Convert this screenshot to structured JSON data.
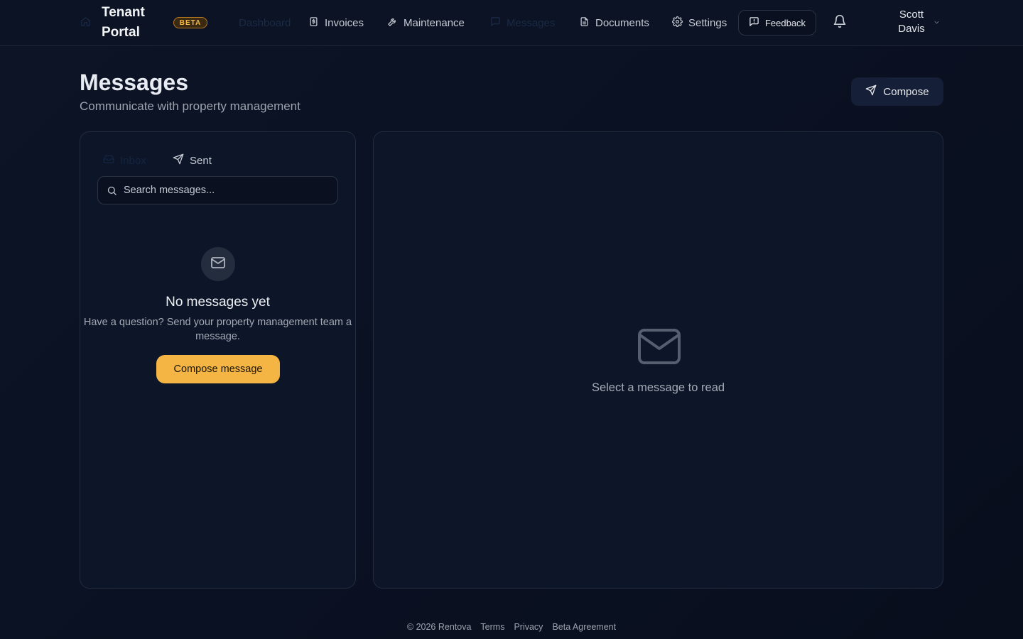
{
  "header": {
    "brand": "Tenant Portal",
    "beta_badge": "BETA",
    "nav": [
      {
        "label": "Dashboard",
        "icon": "home-icon",
        "active": false
      },
      {
        "label": "Invoices",
        "icon": "dollar-file-icon"
      },
      {
        "label": "Maintenance",
        "icon": "wrench-icon"
      },
      {
        "label": "Messages",
        "icon": "chat-icon",
        "active": true
      },
      {
        "label": "Documents",
        "icon": "document-icon"
      },
      {
        "label": "Settings",
        "icon": "gear-icon"
      }
    ],
    "feedback_label": "Feedback",
    "user_name": "Scott Davis"
  },
  "page": {
    "title": "Messages",
    "subtitle": "Communicate with property management",
    "compose_label": "Compose"
  },
  "list_panel": {
    "tabs": [
      {
        "label": "Inbox",
        "icon": "inbox-icon"
      },
      {
        "label": "Sent",
        "icon": "send-icon"
      }
    ],
    "search_placeholder": "Search messages...",
    "empty_title": "No messages yet",
    "empty_text": "Have a question? Send your property management team a message.",
    "compose_message_label": "Compose message"
  },
  "reader_panel": {
    "placeholder_text": "Select a message to read"
  },
  "footer": {
    "copyright": "© 2026 Rentova",
    "links": [
      "Terms",
      "Privacy",
      "Beta Agreement"
    ]
  },
  "colors": {
    "background": "#0a1122",
    "accent": "#f5b544",
    "panel": "#0d1629"
  }
}
